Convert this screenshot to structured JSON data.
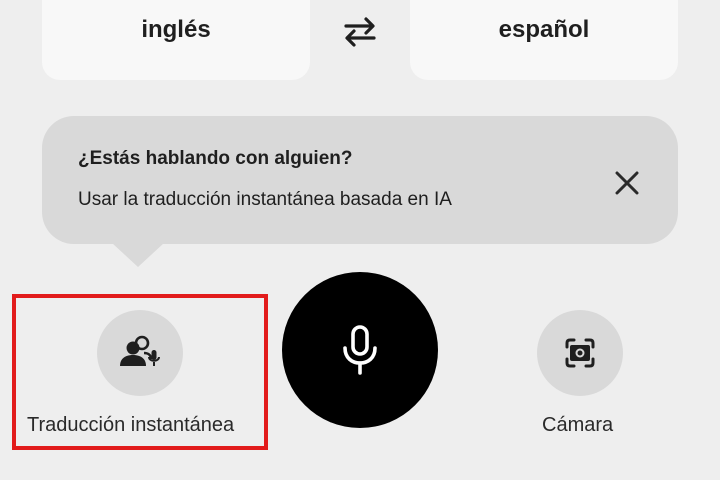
{
  "languages": {
    "source": "inglés",
    "target": "español",
    "swap_icon": "swap-arrows-icon"
  },
  "tooltip": {
    "title": "¿Estás hablando con alguien?",
    "body": "Usar la traducción instantánea basada en IA",
    "close_icon": "close-icon"
  },
  "actions": {
    "instant_translation": {
      "label": "Traducción instantánea",
      "icon": "people-mic-icon"
    },
    "microphone": {
      "icon": "microphone-icon"
    },
    "camera": {
      "label": "Cámara",
      "icon": "camera-lens-icon"
    }
  },
  "colors": {
    "background": "#eeeeee",
    "tooltip": "#d9d9d9",
    "highlight": "#e21b1b",
    "mic_button": "#000000"
  }
}
